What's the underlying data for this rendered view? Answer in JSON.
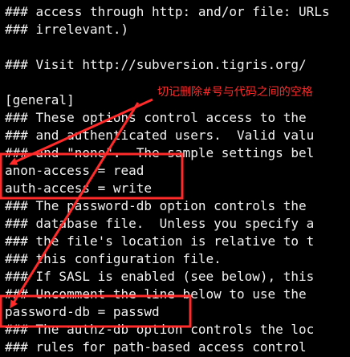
{
  "terminal": {
    "lines": [
      "### access through http: and/or file: URLs",
      "### irrelevant.)",
      "",
      "### Visit http://subversion.tigris.org/",
      "",
      "[general]",
      "### These options control access to the",
      "### and authenticated users.  Valid valu",
      "### and \"none\".  The sample settings bel",
      "anon-access = read",
      "auth-access = write",
      "### The password-db option controls the",
      "### database file.  Unless you specify a",
      "### the file's location is relative to t",
      "### this configuration file.",
      "### If SASL is enabled (see below), this",
      "### Uncomment the line below to use the",
      "password-db = passwd",
      "### The authz-db option controls the loc",
      "### rules for path-based access control"
    ]
  },
  "annotation": {
    "text": "切记删除#号与代码之间的空格",
    "color": "#ff2a2a"
  }
}
